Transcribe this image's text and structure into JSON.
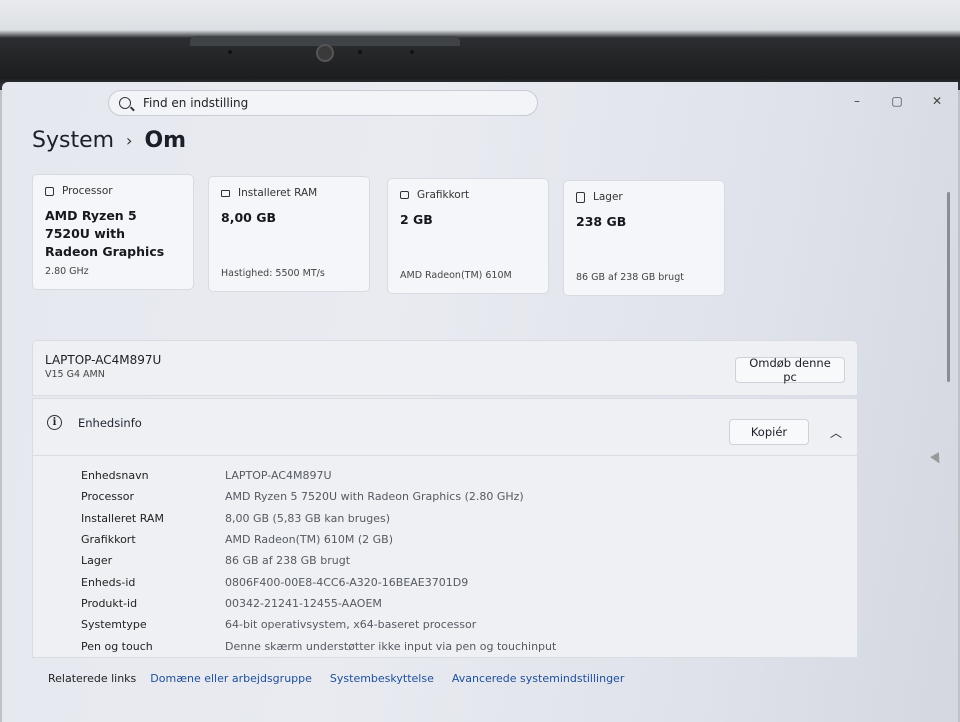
{
  "search": {
    "placeholder": "Find en indstilling"
  },
  "window_controls": {
    "minimize": "–",
    "maximize": "▢",
    "close": "✕"
  },
  "breadcrumb": {
    "parent": "System",
    "separator": "›",
    "current": "Om"
  },
  "cards": [
    {
      "title": "Processor",
      "value": "AMD Ryzen 5 7520U with Radeon Graphics",
      "sub": "2.80 GHz",
      "icon": "processor-icon"
    },
    {
      "title": "Installeret RAM",
      "value": "8,00 GB",
      "sub": "Hastighed: 5500 MT/s",
      "icon": "ram-icon"
    },
    {
      "title": "Grafikkort",
      "value": "2 GB",
      "sub": "AMD Radeon(TM) 610M",
      "icon": "graphics-card-icon"
    },
    {
      "title": "Lager",
      "value": "238 GB",
      "sub": "86 GB af 238 GB brugt",
      "icon": "storage-icon"
    }
  ],
  "device": {
    "name": "LAPTOP-AC4M897U",
    "model": "V15 G4 AMN",
    "rename_label": "Omdøb denne pc"
  },
  "device_info": {
    "title": "Enhedsinfo",
    "copy_label": "Kopiér",
    "rows": [
      {
        "key": "Enhedsnavn",
        "value": "LAPTOP-AC4M897U"
      },
      {
        "key": "Processor",
        "value": "AMD Ryzen 5 7520U with Radeon Graphics (2.80 GHz)"
      },
      {
        "key": "Installeret RAM",
        "value": "8,00 GB (5,83 GB kan bruges)"
      },
      {
        "key": "Grafikkort",
        "value": "AMD Radeon(TM) 610M (2 GB)"
      },
      {
        "key": "Lager",
        "value": "86 GB af 238 GB brugt"
      },
      {
        "key": "Enheds-id",
        "value": "0806F400-00E8-4CC6-A320-16BEAE3701D9"
      },
      {
        "key": "Produkt-id",
        "value": "00342-21241-12455-AAOEM"
      },
      {
        "key": "Systemtype",
        "value": "64-bit operativsystem, x64-baseret processor"
      },
      {
        "key": "Pen og touch",
        "value": "Denne skærm understøtter ikke input via pen og touchinput"
      }
    ]
  },
  "related": {
    "label": "Relaterede links",
    "links": [
      "Domæne eller arbejdsgruppe",
      "Systembeskyttelse",
      "Avancerede systemindstillinger"
    ]
  }
}
